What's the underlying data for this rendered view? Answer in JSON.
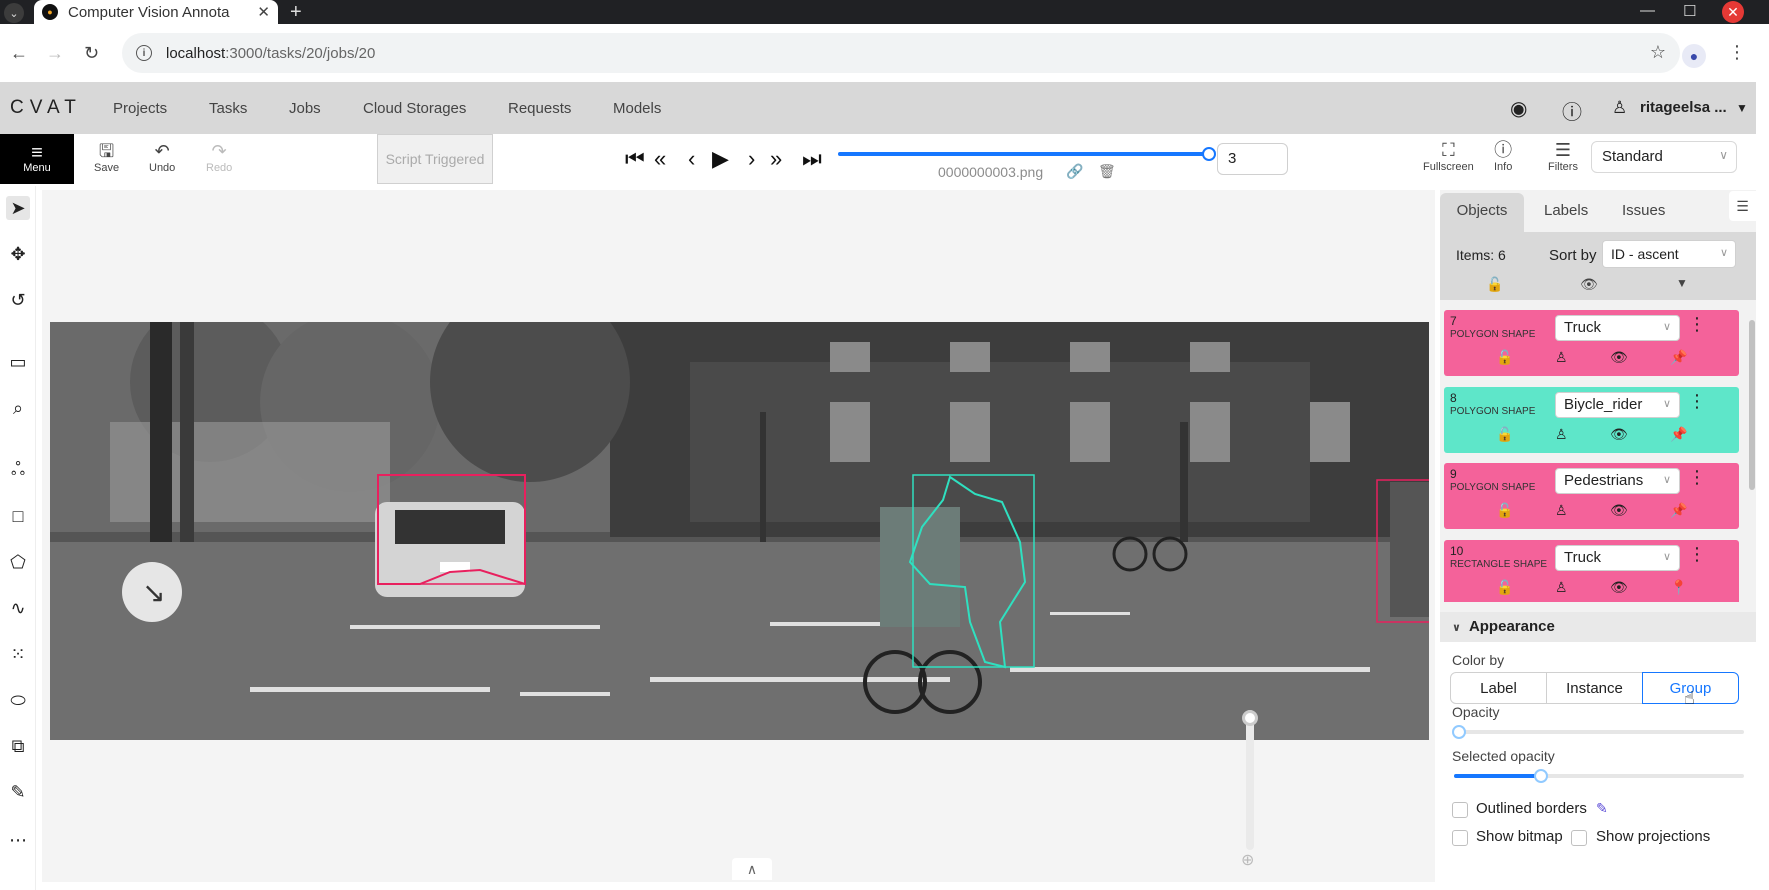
{
  "browser": {
    "tab_title": "Computer Vision Annota",
    "url_host": "localhost",
    "url_path": ":3000/tasks/20/jobs/20"
  },
  "header": {
    "logo": "CVAT",
    "nav": [
      "Projects",
      "Tasks",
      "Jobs",
      "Cloud Storages",
      "Requests",
      "Models"
    ],
    "username": "ritageelsa ..."
  },
  "toolbar": {
    "menu_label": "Menu",
    "save_label": "Save",
    "undo_label": "Undo",
    "redo_label": "Redo",
    "script_label": "Script Triggered",
    "frame_number": "3",
    "filename": "0000000003.png",
    "frame_progress": 1.0,
    "fullscreen_label": "Fullscreen",
    "info_label": "Info",
    "filters_label": "Filters",
    "workspace": "Standard"
  },
  "sidebar": {
    "tabs": [
      "Objects",
      "Labels",
      "Issues"
    ],
    "items_count": "Items: 6",
    "sort_label": "Sort by",
    "sort_value": "ID - ascent",
    "objects": [
      {
        "id": "7",
        "type": "POLYGON SHAPE",
        "label": "Truck",
        "color": "#f4629a"
      },
      {
        "id": "8",
        "type": "POLYGON SHAPE",
        "label": "Biycle_rider",
        "color": "#5ee6c9"
      },
      {
        "id": "9",
        "type": "POLYGON SHAPE",
        "label": "Pedestrians",
        "color": "#f4629a"
      },
      {
        "id": "10",
        "type": "RECTANGLE SHAPE",
        "label": "Truck",
        "color": "#f4629a"
      }
    ]
  },
  "appearance": {
    "title": "Appearance",
    "color_by_label": "Color by",
    "color_by_options": [
      "Label",
      "Instance",
      "Group"
    ],
    "color_by_selected": "Group",
    "opacity_label": "Opacity",
    "opacity_value": 0,
    "selected_opacity_label": "Selected opacity",
    "selected_opacity_value": 0.3,
    "outlined_borders_label": "Outlined borders",
    "show_bitmap_label": "Show bitmap",
    "show_projections_label": "Show projections"
  },
  "colors": {
    "accent": "#1677ff",
    "truck": "#e8205e",
    "rider": "#2fe0c0"
  }
}
